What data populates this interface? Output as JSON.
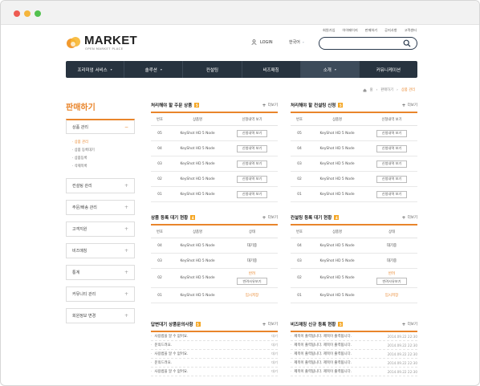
{
  "util_links": [
    "회원가입",
    "아이페이지",
    "판매하기",
    "공지사항",
    "고객센터"
  ],
  "logo": {
    "title": "MARKET",
    "subtitle": "OPEN MARKET PLACE"
  },
  "login_label": "LOGIN",
  "language": "한국어",
  "search": {
    "placeholder": ""
  },
  "gnb": [
    {
      "label": "프리미엄 서비스",
      "has_menu": true,
      "active": false
    },
    {
      "label": "솔루션",
      "has_menu": true,
      "active": false
    },
    {
      "label": "컨설팅",
      "has_menu": false,
      "active": false
    },
    {
      "label": "비즈매칭",
      "has_menu": false,
      "active": false
    },
    {
      "label": "소개",
      "has_menu": true,
      "active": true
    },
    {
      "label": "커뮤니케이션",
      "has_menu": false,
      "active": false
    }
  ],
  "breadcrumb": [
    "홈",
    "판매하기",
    "상품 관리"
  ],
  "lnb": {
    "title": "판매하기",
    "active_menu": "상품 관리",
    "active_sign": "−",
    "sub_items": [
      "상품 관리",
      "상품 등록대기",
      "상품등록",
      "삭제목록"
    ],
    "other_menus": [
      "컨설팅 관리",
      "주문/배송 관리",
      "고객지원",
      "비즈매칭",
      "통계",
      "커뮤니티 관리",
      "회원정보 변경"
    ],
    "closed_sign": "+"
  },
  "more_label": "더보기",
  "panels": {
    "order_product": {
      "title": "처리해야 할 주문 상품",
      "count": "5",
      "headers": [
        "번호",
        "상품명",
        "신청내역 보기"
      ],
      "rows": [
        {
          "no": "05",
          "name": "KeyShot HD 5 Node",
          "action": "신청내역 보기"
        },
        {
          "no": "04",
          "name": "KeyShot HD 5 Node",
          "action": "신청내역 보기"
        },
        {
          "no": "03",
          "name": "KeyShot HD 5 Node",
          "action": "신청내역 보기"
        },
        {
          "no": "02",
          "name": "KeyShot HD 5 Node",
          "action": "신청내역 보기"
        },
        {
          "no": "01",
          "name": "KeyShot HD 5 Node",
          "action": "신청내역 보기"
        }
      ]
    },
    "consulting_req": {
      "title": "처리해야 할 컨설팅 신청",
      "count": "5",
      "headers": [
        "번호",
        "상품명",
        "신청내역 보기"
      ],
      "rows": [
        {
          "no": "05",
          "name": "KeyShot HD 5 Node",
          "action": "신청내역 보기"
        },
        {
          "no": "04",
          "name": "KeyShot HD 5 Node",
          "action": "신청내역 보기"
        },
        {
          "no": "03",
          "name": "KeyShot HD 5 Node",
          "action": "신청내역 보기"
        },
        {
          "no": "02",
          "name": "KeyShot HD 5 Node",
          "action": "신청내역 보기"
        },
        {
          "no": "01",
          "name": "KeyShot HD 5 Node",
          "action": "신청내역 보기"
        }
      ]
    },
    "product_wait": {
      "title": "상품 등록 대기 현황",
      "count": "4",
      "headers": [
        "번호",
        "상품명",
        "상태"
      ],
      "rows": [
        {
          "no": "04",
          "name": "KeyShot HD 5 Node",
          "status": "대기중"
        },
        {
          "no": "03",
          "name": "KeyShot HD 5 Node",
          "status": "대기중"
        },
        {
          "no": "02",
          "name": "KeyShot HD 5 Node",
          "status": "반려",
          "button": "반려사유보기"
        },
        {
          "no": "01",
          "name": "KeyShot HD 5 Node",
          "status": "임시저장"
        }
      ]
    },
    "consulting_wait": {
      "title": "컨설팅 등록 대기 현황",
      "count": "4",
      "headers": [
        "번호",
        "상품명",
        "상태"
      ],
      "rows": [
        {
          "no": "04",
          "name": "KeyShot HD 5 Node",
          "status": "대기중"
        },
        {
          "no": "03",
          "name": "KeyShot HD 5 Node",
          "status": "대기중"
        },
        {
          "no": "02",
          "name": "KeyShot HD 5 Node",
          "status": "반려",
          "button": "반려사유보기"
        },
        {
          "no": "01",
          "name": "KeyShot HD 5 Node",
          "status": "임시저장"
        }
      ]
    },
    "qna": {
      "title": "답변대기 상품문의사항",
      "count": "5",
      "rows": [
        {
          "text": "사용법을 알 수 없어요.",
          "right": "대기"
        },
        {
          "text": "문의드려요.",
          "right": "대기"
        },
        {
          "text": "사용법을 알 수 없어요.",
          "right": "대기"
        },
        {
          "text": "문의드려요.",
          "right": "대기"
        },
        {
          "text": "사용법을 알 수 없어요.",
          "right": "대기"
        }
      ]
    },
    "biz": {
      "title": "비즈매칭 신규 등록 현황",
      "count": "5",
      "rows": [
        {
          "text": "제목이 출력됩니다. 제목이 출력됩니다.",
          "right": "2014.09.22 22:30"
        },
        {
          "text": "제목이 출력됩니다. 제목이 출력됩니다.",
          "right": "2014.09.22 22:30"
        },
        {
          "text": "제목이 출력됩니다. 제목이 출력됩니다.",
          "right": "2014.09.22 22:30"
        },
        {
          "text": "제목이 출력됩니다. 제목이 출력됩니다.",
          "right": "2014.09.22 22:30"
        },
        {
          "text": "제목이 출력됩니다. 제목이 출력됩니다.",
          "right": "2014.09.22 22:30"
        }
      ]
    }
  },
  "colors": {
    "accent": "#e9852b",
    "nav": "#27333f",
    "badge": "#f5a623"
  }
}
